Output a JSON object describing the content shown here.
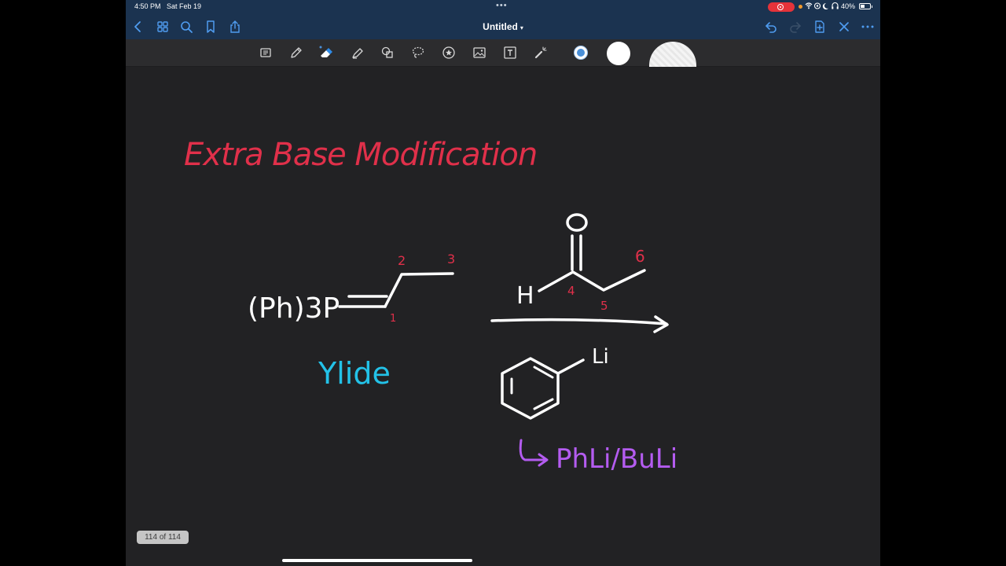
{
  "status_bar": {
    "time": "4:50 PM",
    "date": "Sat Feb 19",
    "battery": "40%"
  },
  "nav": {
    "title": "Untitled",
    "left_icons": [
      "back-icon",
      "grid-icon",
      "search-icon",
      "bookmark-icon",
      "share-icon"
    ],
    "right_icons": [
      "undo-icon",
      "redo-icon",
      "add-page-icon",
      "close-icon",
      "more-icon"
    ]
  },
  "toolbar": {
    "tools": [
      "read-mode-icon",
      "pen-icon",
      "eraser-icon",
      "highlighter-icon",
      "shapes-icon",
      "lasso-icon",
      "sticker-icon",
      "image-icon",
      "text-icon",
      "laser-pointer-icon"
    ],
    "colors": [
      "#4a90d9",
      "#ffffff",
      "#eeeeee"
    ]
  },
  "note": {
    "heading": "Extra Base Modification",
    "ylide_formula": "(Ph)3P",
    "ylide_label": "Ylide",
    "carbon_numbers": [
      "1",
      "2",
      "3",
      "4",
      "5",
      "6"
    ],
    "aldehyde_O": "O",
    "aldehyde_H": "H",
    "reagent_Li": "Li",
    "reagent_note": "PhLi/BuLi"
  },
  "colors": {
    "heading": "#e0304a",
    "numbers": "#e0304a",
    "ylide": "#23c2e8",
    "reagent_note": "#b45cf0",
    "ink": "#ffffff"
  },
  "page_counter": "114 of 114"
}
